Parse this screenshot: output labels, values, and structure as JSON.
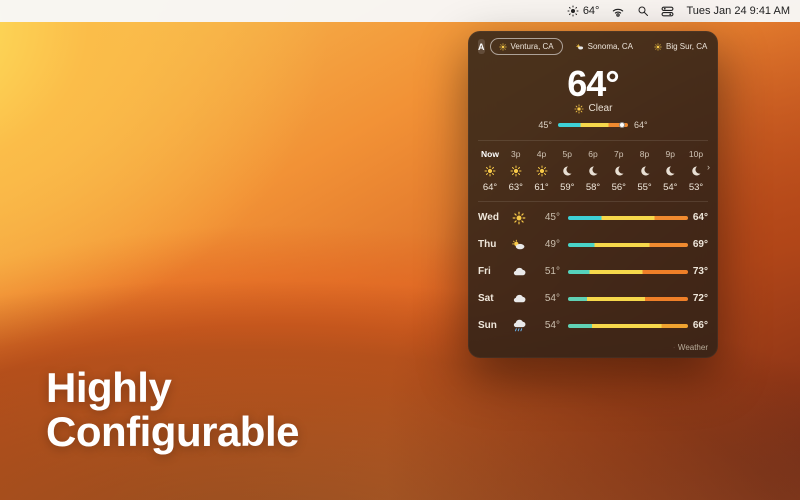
{
  "menubar": {
    "temp": "64°",
    "date_time": "Tues Jan 24  9:41 AM"
  },
  "tagline": {
    "line1": "Highly",
    "line2": "Configurable"
  },
  "panel": {
    "auto_label": "A",
    "locations": [
      {
        "name": "Ventura, CA",
        "icon": "sun",
        "active": true
      },
      {
        "name": "Sonoma, CA",
        "icon": "partly",
        "active": false
      },
      {
        "name": "Big Sur, CA",
        "icon": "sun",
        "active": false
      }
    ],
    "current": {
      "temp": "64°",
      "condition": "Clear",
      "icon": "sun",
      "lo": "45°",
      "hi": "64°",
      "marker_pct": 92
    },
    "hourly": [
      {
        "time": "Now",
        "icon": "sun",
        "temp": "64°",
        "now": true
      },
      {
        "time": "3p",
        "icon": "sun",
        "temp": "63°"
      },
      {
        "time": "4p",
        "icon": "sun",
        "temp": "61°"
      },
      {
        "time": "5p",
        "icon": "moon",
        "temp": "59°"
      },
      {
        "time": "6p",
        "icon": "moon",
        "temp": "58°"
      },
      {
        "time": "7p",
        "icon": "moon",
        "temp": "56°"
      },
      {
        "time": "8p",
        "icon": "moon",
        "temp": "55°"
      },
      {
        "time": "9p",
        "icon": "moon",
        "temp": "54°"
      },
      {
        "time": "10p",
        "icon": "moon",
        "temp": "53°"
      }
    ],
    "daily": [
      {
        "day": "Wed",
        "icon": "sun",
        "lo": "45°",
        "hi": "64°",
        "bar": {
          "c1": "#3ed1d6",
          "p1": 28,
          "c2": "#f6d84b",
          "p2": 72,
          "c3": "#f08a2f"
        }
      },
      {
        "day": "Thu",
        "icon": "partly",
        "lo": "49°",
        "hi": "69°",
        "bar": {
          "c1": "#49d4c8",
          "p1": 22,
          "c2": "#f6d84b",
          "p2": 68,
          "c3": "#f08a2f"
        }
      },
      {
        "day": "Fri",
        "icon": "cloud",
        "lo": "51°",
        "hi": "73°",
        "bar": {
          "c1": "#55d3bd",
          "p1": 18,
          "c2": "#f6d84b",
          "p2": 62,
          "c3": "#ef7f28"
        }
      },
      {
        "day": "Sat",
        "icon": "cloud",
        "lo": "54°",
        "hi": "72°",
        "bar": {
          "c1": "#60d1b4",
          "p1": 16,
          "c2": "#f6d84b",
          "p2": 64,
          "c3": "#ef7f28"
        }
      },
      {
        "day": "Sun",
        "icon": "rain",
        "lo": "54°",
        "hi": "66°",
        "bar": {
          "c1": "#60d1b4",
          "p1": 20,
          "c2": "#f6d84b",
          "p2": 78,
          "c3": "#f0a330"
        }
      }
    ],
    "attribution": "Weather"
  }
}
